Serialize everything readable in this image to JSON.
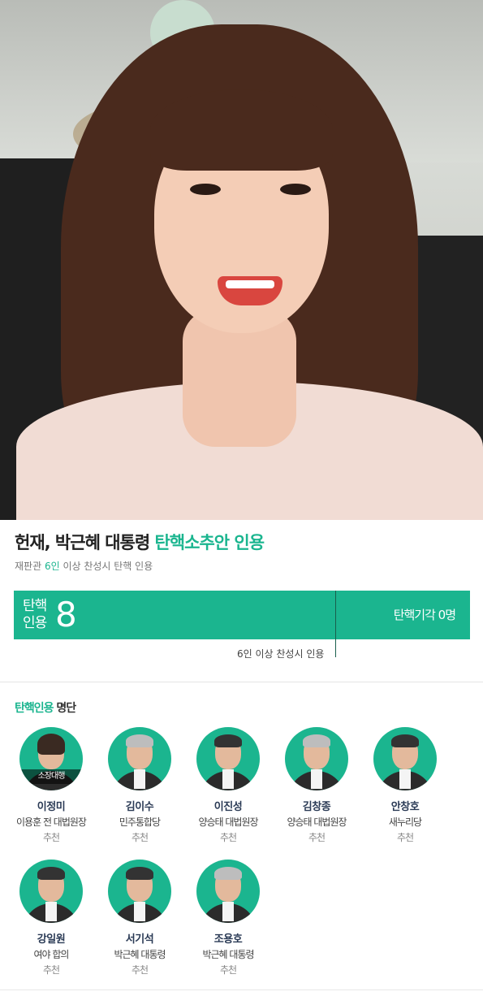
{
  "headline": {
    "prefix": "헌재, 박근혜 대통령 ",
    "accent": "탄핵소추안 인용"
  },
  "subline": {
    "prefix": "재판관 ",
    "accent": "6인",
    "suffix": " 이상 찬성시 탄핵 인용"
  },
  "vote": {
    "approve_label_1": "탄핵",
    "approve_label_2": "인용",
    "approve_count": "8",
    "reject_text": "탄핵기각 0명",
    "threshold_text": "6인 이상 찬성시 인용",
    "accent_color": "#1bb58f"
  },
  "list": {
    "title_accent": "탄핵인용",
    "title_plain": " 명단"
  },
  "judges": [
    {
      "name": "이정미",
      "recommender": "이용훈 전 대법원장",
      "note": "추천",
      "tag": "소장대행"
    },
    {
      "name": "김이수",
      "recommender": "민주통합당",
      "note": "추천"
    },
    {
      "name": "이진성",
      "recommender": "양승태 대법원장",
      "note": "추천"
    },
    {
      "name": "김창종",
      "recommender": "양승태 대법원장",
      "note": "추천"
    },
    {
      "name": "안창호",
      "recommender": "새누리당",
      "note": "추천"
    },
    {
      "name": "강일원",
      "recommender": "여야 합의",
      "note": "추천"
    },
    {
      "name": "서기석",
      "recommender": "박근혜 대통령",
      "note": "추천"
    },
    {
      "name": "조용호",
      "recommender": "박근혜 대통령",
      "note": "추천"
    }
  ]
}
